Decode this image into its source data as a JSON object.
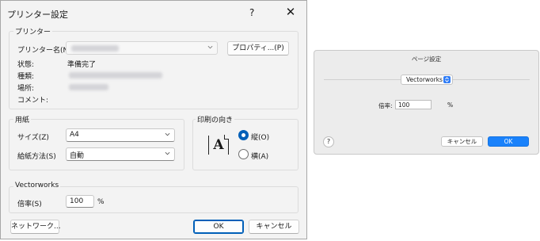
{
  "windows_dialog": {
    "title": "プリンター設定",
    "help_symbol": "?",
    "close_symbol": "✕",
    "printer_group": {
      "legend": "プリンター",
      "name_label": "プリンター名(N):",
      "properties_button": "プロパティ...(P)",
      "status_label": "状態:",
      "status_value": "準備完了",
      "type_label": "種類:",
      "location_label": "場所:",
      "comment_label": "コメント:"
    },
    "paper_group": {
      "legend": "用紙",
      "size_label": "サイズ(Z)",
      "size_value": "A4",
      "source_label": "給紙方法(S)",
      "source_value": "自動"
    },
    "orientation_group": {
      "legend": "印刷の向き",
      "icon_letter": "A",
      "portrait_label": "縦(O)",
      "landscape_label": "横(A)",
      "selected": "portrait"
    },
    "vectorworks_group": {
      "legend": "Vectorworks",
      "scale_label": "倍率(S)",
      "scale_value": "100",
      "unit": "%"
    },
    "network_button": "ネットワーク...",
    "ok_button": "OK",
    "cancel_button": "キャンセル",
    "accent_color": "#005fb8"
  },
  "mac_panel": {
    "title": "ページ設定",
    "popup_value": "Vectorworks",
    "scale_label": "倍率:",
    "scale_value": "100",
    "unit": "%",
    "help_symbol": "?",
    "cancel_button": "キャンセル",
    "ok_button": "OK",
    "accent_color": "#1a82fb"
  }
}
